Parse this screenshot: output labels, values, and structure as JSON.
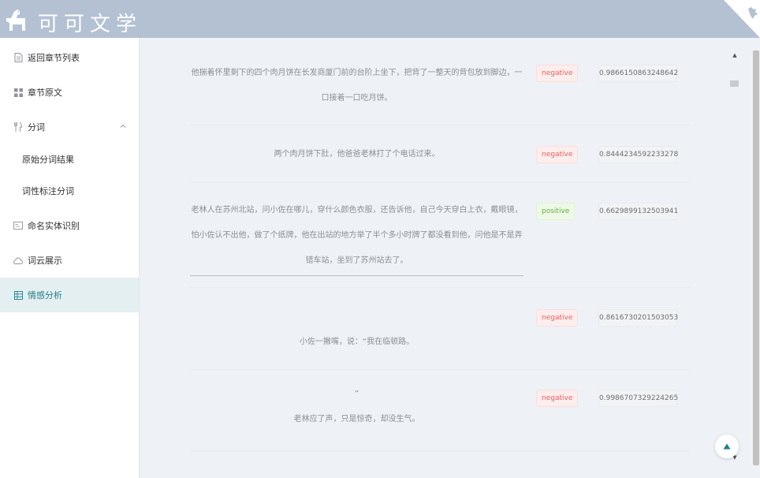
{
  "header": {
    "brand": "可可文学"
  },
  "sidebar": {
    "items": [
      {
        "label": "返回章节列表",
        "icon": "document-icon"
      },
      {
        "label": "章节原文",
        "icon": "grid-icon"
      },
      {
        "label": "分词",
        "icon": "utensils-icon",
        "expanded": true
      },
      {
        "label": "原始分词结果"
      },
      {
        "label": "词性标注分词"
      },
      {
        "label": "命名实体识别",
        "icon": "id-card-icon"
      },
      {
        "label": "词云展示",
        "icon": "cloud-icon"
      },
      {
        "label": "情感分析",
        "icon": "table-icon",
        "active": true
      }
    ]
  },
  "rows": [
    {
      "lines": [
        "他揣着怀里剩下的四个肉月饼在长发商厦门前的台阶上坐下，把背了一整天的背包放到脚边，一",
        "口接着一口吃月饼。"
      ],
      "sentiment": "negative",
      "score": "0.9866150863248642"
    },
    {
      "lines": [
        "两个肉月饼下肚，他爸爸老林打了个电话过来。"
      ],
      "sentiment": "negative",
      "score": "0.8444234592233278"
    },
    {
      "lines": [
        "老林人在苏州北站，问小佐在哪儿，穿什么颜色衣服，还告诉他，自己今天穿白上衣，戴眼镜，",
        "怕小佐认不出他，做了个纸牌，他在出站的地方举了半个多小时牌了都没看到他，问他是不是弄",
        "错车站，坐到了苏州站去了。"
      ],
      "sentiment": "positive",
      "score": "0.6629899132503941"
    },
    {
      "lines": [
        "小佐一撇嘴，说：“我在临顿路。"
      ],
      "sentiment": "negative",
      "score": "0.8616730201503053"
    },
    {
      "lines": [
        "”",
        "老林应了声，只是惊奇，却没生气。"
      ],
      "sentiment": "negative",
      "score": "0.9986707329224265"
    }
  ],
  "colors": {
    "header": "#b3c1d3",
    "accent": "#1e7f8a",
    "negative": "#ef5d5d",
    "positive": "#60b33a"
  }
}
